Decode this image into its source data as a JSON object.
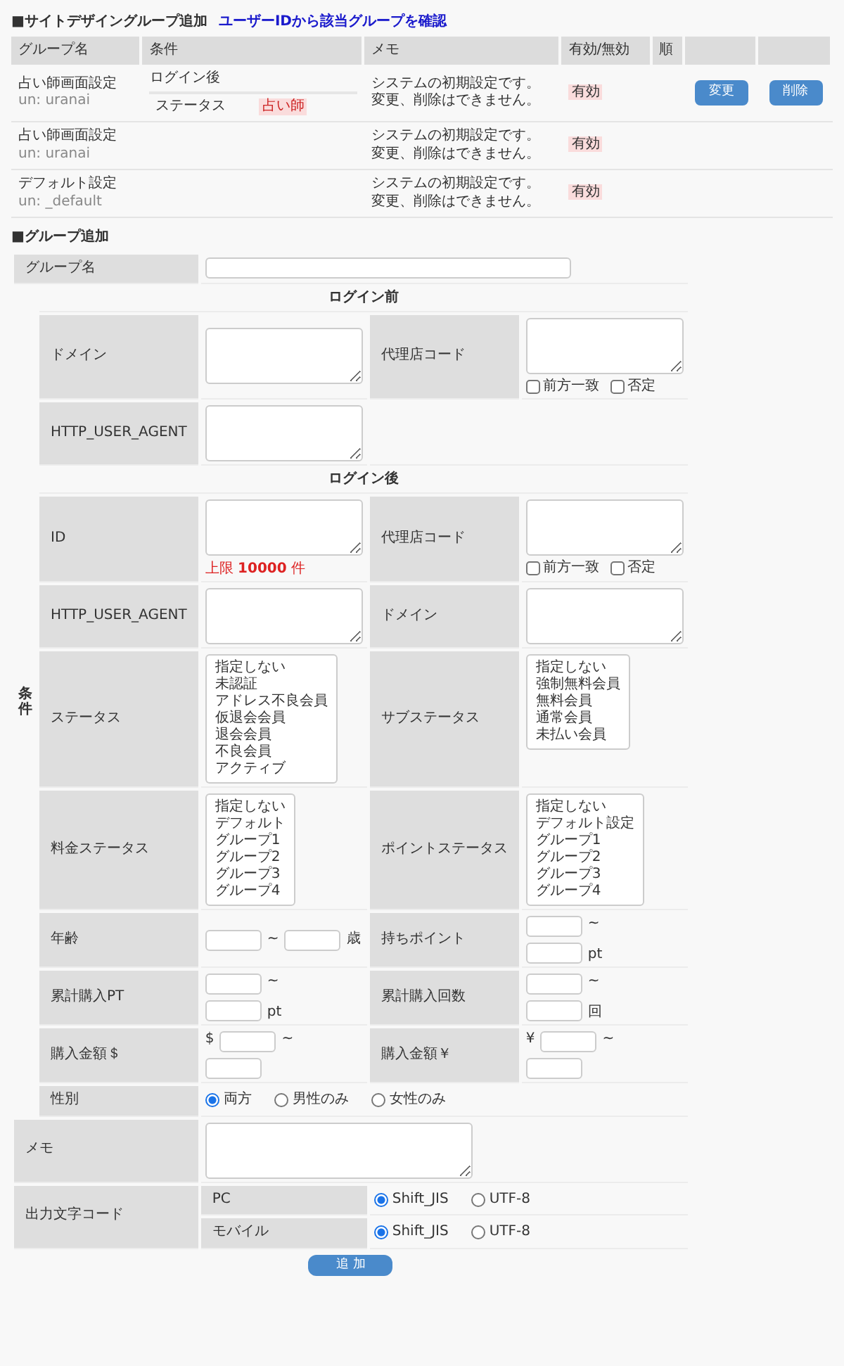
{
  "heading": {
    "title": "■サイトデザイングループ追加",
    "link": "ユーザーIDから該当グループを確認"
  },
  "groups": {
    "columns": [
      "グループ名",
      "条件",
      "メモ",
      "有効/無効",
      "順"
    ],
    "rows": [
      {
        "name": "占い師画面設定",
        "un": "un: uranai",
        "condition": {
          "heading": "ログイン後",
          "items": [
            {
              "label": "ステータス",
              "value": "占い師"
            }
          ]
        },
        "memo": [
          "システムの初期設定です。",
          "変更、削除はできません。"
        ],
        "status": "有効",
        "buttons": [
          "変更",
          "削除"
        ]
      },
      {
        "name": "占い師画面設定",
        "un": "un: uranai",
        "memo": [
          "システムの初期設定です。",
          "変更、削除はできません。"
        ],
        "status": "有効"
      },
      {
        "name": "デフォルト設定",
        "un": "un: _default",
        "memo": [
          "システムの初期設定です。",
          "変更、削除はできません。"
        ],
        "status": "有効"
      }
    ]
  },
  "form": {
    "title": "■グループ追加",
    "group_name_label": "グループ名",
    "side_label": "条件",
    "sections": [
      {
        "heading": "ログイン前",
        "rows": [
          [
            {
              "kind": "textarea",
              "label": "ドメイン"
            },
            {
              "kind": "textarea",
              "label": "代理店コード",
              "checks": [
                {
                  "label": "前方一致",
                  "checked": false
                },
                {
                  "label": "否定",
                  "checked": false
                }
              ]
            }
          ],
          [
            {
              "kind": "textarea",
              "label": "HTTP_USER_AGENT"
            }
          ]
        ]
      },
      {
        "heading": "ログイン後",
        "rows": [
          [
            {
              "kind": "textarea",
              "label": "ID",
              "note": "上限 **10000** 件"
            },
            {
              "kind": "textarea",
              "label": "代理店コード",
              "checks": [
                {
                  "label": "前方一致",
                  "checked": false
                },
                {
                  "label": "否定",
                  "checked": false
                }
              ]
            }
          ],
          [
            {
              "kind": "textarea",
              "label": "HTTP_USER_AGENT"
            },
            {
              "kind": "textarea",
              "label": "ドメイン"
            }
          ],
          [
            {
              "kind": "select",
              "label": "ステータス",
              "options": [
                "指定しない",
                "未認証",
                "アドレス不良会員",
                "仮退会会員",
                "退会会員",
                "不良会員",
                "アクティブ"
              ]
            },
            {
              "kind": "select",
              "label": "サブステータス",
              "options": [
                "指定しない",
                "強制無料会員",
                "無料会員",
                "通常会員",
                "未払い会員"
              ]
            }
          ],
          [
            {
              "kind": "select",
              "label": "料金ステータス",
              "options": [
                "指定しない",
                "デフォルト",
                "グループ1",
                "グループ2",
                "グループ3",
                "グループ4"
              ]
            },
            {
              "kind": "select",
              "label": "ポイントステータス",
              "options": [
                "指定しない",
                "デフォルト設定",
                "グループ1",
                "グループ2",
                "グループ3",
                "グループ4"
              ]
            }
          ],
          [
            {
              "kind": "range_inline",
              "label": "年齢",
              "separator": "~",
              "unit": "歳"
            },
            {
              "kind": "range_stacked",
              "label": "持ちポイント",
              "separator": "~",
              "unit": "pt"
            }
          ],
          [
            {
              "kind": "range_stacked",
              "label": "累計購入PT",
              "separator": "~",
              "unit": "pt"
            },
            {
              "kind": "range_stacked",
              "label": "累計購入回数",
              "separator": "~",
              "unit": "回"
            }
          ],
          [
            {
              "kind": "range_stacked",
              "label": "購入金額＄",
              "prefix": "$",
              "separator": "~"
            },
            {
              "kind": "range_stacked",
              "label": "購入金額￥",
              "prefix": "¥",
              "separator": "~"
            }
          ],
          [
            {
              "kind": "radio",
              "label": "性別",
              "options": [
                {
                  "label": "両方",
                  "selected": true
                },
                {
                  "label": "男性のみ",
                  "selected": false
                },
                {
                  "label": "女性のみ",
                  "selected": false
                }
              ]
            }
          ]
        ]
      }
    ],
    "memo_label": "メモ",
    "encoding": {
      "label": "出力文字コード",
      "rows": [
        {
          "label": "PC",
          "options": [
            {
              "label": "Shift_JIS",
              "selected": true
            },
            {
              "label": "UTF-8",
              "selected": false
            }
          ]
        },
        {
          "label": "モバイル",
          "options": [
            {
              "label": "Shift_JIS",
              "selected": true
            },
            {
              "label": "UTF-8",
              "selected": false
            }
          ]
        }
      ]
    },
    "submit": "追 加"
  }
}
